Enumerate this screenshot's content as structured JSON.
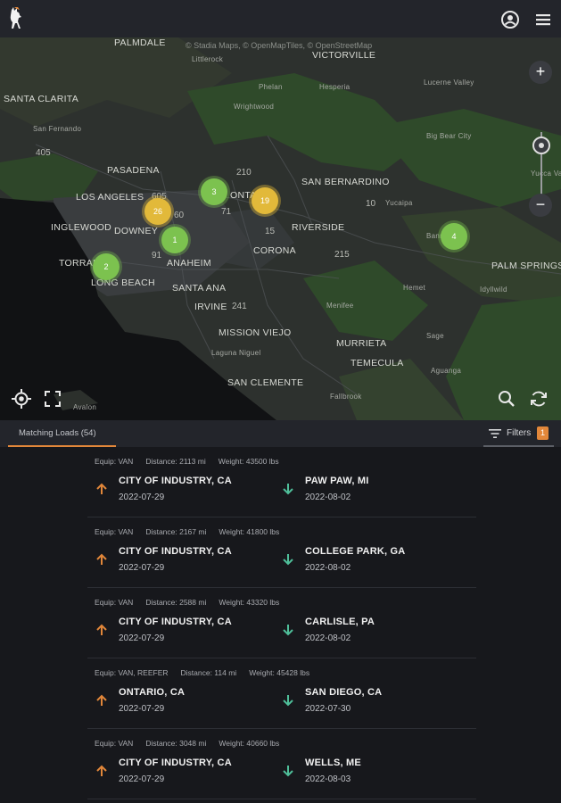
{
  "map": {
    "attribution": "© Stadia Maps, © OpenMapTiles, © OpenStreetMap",
    "places": [
      {
        "name": "PALMDALE",
        "size": "big"
      },
      {
        "name": "VICTORVILLE",
        "size": "big"
      },
      {
        "name": "SANTA CLARITA",
        "size": "big"
      },
      {
        "name": "Littlerock",
        "size": "small"
      },
      {
        "name": "Phelan",
        "size": "small"
      },
      {
        "name": "Hesperia",
        "size": "small"
      },
      {
        "name": "Lucerne Valley",
        "size": "small"
      },
      {
        "name": "Wrightwood",
        "size": "small"
      },
      {
        "name": "San Fernando",
        "size": "small"
      },
      {
        "name": "Big Bear City",
        "size": "small"
      },
      {
        "name": "PASADENA",
        "size": "big"
      },
      {
        "name": "SAN BERNARDINO",
        "size": "big"
      },
      {
        "name": "LOS ANGELES",
        "size": "big"
      },
      {
        "name": "ONTARIO",
        "size": "big"
      },
      {
        "name": "Yucaipa",
        "size": "small"
      },
      {
        "name": "INGLEWOOD",
        "size": "big"
      },
      {
        "name": "DOWNEY",
        "size": "big"
      },
      {
        "name": "RIVERSIDE",
        "size": "big"
      },
      {
        "name": "CORONA",
        "size": "big"
      },
      {
        "name": "Banning",
        "size": "small"
      },
      {
        "name": "TORRANCE",
        "size": "big"
      },
      {
        "name": "ANAHEIM",
        "size": "big"
      },
      {
        "name": "LONG BEACH",
        "size": "big"
      },
      {
        "name": "SANTA ANA",
        "size": "big"
      },
      {
        "name": "PALM SPRINGS",
        "size": "big"
      },
      {
        "name": "Hemet",
        "size": "small"
      },
      {
        "name": "Idyllwild",
        "size": "small"
      },
      {
        "name": "IRVINE",
        "size": "big"
      },
      {
        "name": "Menifee",
        "size": "small"
      },
      {
        "name": "MISSION VIEJO",
        "size": "big"
      },
      {
        "name": "MURRIETA",
        "size": "big"
      },
      {
        "name": "Laguna Niguel",
        "size": "small"
      },
      {
        "name": "TEMECULA",
        "size": "big"
      },
      {
        "name": "Sage",
        "size": "small"
      },
      {
        "name": "Aguanga",
        "size": "small"
      },
      {
        "name": "SAN CLEMENTE",
        "size": "big"
      },
      {
        "name": "Fallbrook",
        "size": "small"
      },
      {
        "name": "Avalon",
        "size": "small"
      },
      {
        "name": "Yucca Valley",
        "size": "small"
      }
    ],
    "highways": [
      "405",
      "210",
      "605",
      "60",
      "71",
      "10",
      "15",
      "91",
      "215",
      "241"
    ],
    "clusters": [
      {
        "count": "3",
        "color": "green"
      },
      {
        "count": "19",
        "color": "yellow"
      },
      {
        "count": "26",
        "color": "yellow"
      },
      {
        "count": "1",
        "color": "green"
      },
      {
        "count": "2",
        "color": "green"
      },
      {
        "count": "4",
        "color": "green"
      }
    ],
    "zoom_in": "+",
    "zoom_out": "−"
  },
  "tabs": {
    "matching_loads": "Matching Loads (54)",
    "filters": "Filters",
    "filters_count": "1"
  },
  "loads": [
    {
      "equip": "Equip: VAN",
      "distance": "Distance: 2113 mi",
      "weight": "Weight: 43500 lbs",
      "origin": "CITY OF INDUSTRY, CA",
      "origin_date": "2022-07-29",
      "dest": "PAW PAW, MI",
      "dest_date": "2022-08-02"
    },
    {
      "equip": "Equip: VAN",
      "distance": "Distance: 2167 mi",
      "weight": "Weight: 41800 lbs",
      "origin": "CITY OF INDUSTRY, CA",
      "origin_date": "2022-07-29",
      "dest": "COLLEGE PARK, GA",
      "dest_date": "2022-08-02"
    },
    {
      "equip": "Equip: VAN",
      "distance": "Distance: 2588 mi",
      "weight": "Weight: 43320 lbs",
      "origin": "CITY OF INDUSTRY, CA",
      "origin_date": "2022-07-29",
      "dest": "CARLISLE, PA",
      "dest_date": "2022-08-02"
    },
    {
      "equip": "Equip: VAN, REEFER",
      "distance": "Distance: 114 mi",
      "weight": "Weight: 45428 lbs",
      "origin": "ONTARIO, CA",
      "origin_date": "2022-07-29",
      "dest": "SAN DIEGO, CA",
      "dest_date": "2022-07-30"
    },
    {
      "equip": "Equip: VAN",
      "distance": "Distance: 3048 mi",
      "weight": "Weight: 40660 lbs",
      "origin": "CITY OF INDUSTRY, CA",
      "origin_date": "2022-07-29",
      "dest": "WELLS, ME",
      "dest_date": "2022-08-03"
    }
  ],
  "colors": {
    "accent": "#e2873a",
    "cluster_green": "#7cc24f",
    "cluster_yellow": "#e2b93a",
    "dest_arrow": "#4fbf9a"
  }
}
